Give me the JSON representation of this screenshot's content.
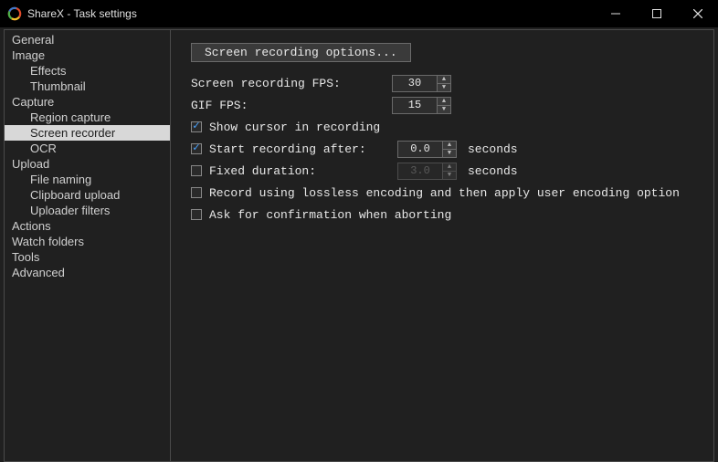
{
  "window": {
    "title": "ShareX - Task settings"
  },
  "sidebar": {
    "items": [
      {
        "label": "General",
        "level": 0,
        "selected": false
      },
      {
        "label": "Image",
        "level": 0,
        "selected": false
      },
      {
        "label": "Effects",
        "level": 1,
        "selected": false
      },
      {
        "label": "Thumbnail",
        "level": 1,
        "selected": false
      },
      {
        "label": "Capture",
        "level": 0,
        "selected": false
      },
      {
        "label": "Region capture",
        "level": 1,
        "selected": false
      },
      {
        "label": "Screen recorder",
        "level": 1,
        "selected": true
      },
      {
        "label": "OCR",
        "level": 1,
        "selected": false
      },
      {
        "label": "Upload",
        "level": 0,
        "selected": false
      },
      {
        "label": "File naming",
        "level": 1,
        "selected": false
      },
      {
        "label": "Clipboard upload",
        "level": 1,
        "selected": false
      },
      {
        "label": "Uploader filters",
        "level": 1,
        "selected": false
      },
      {
        "label": "Actions",
        "level": 0,
        "selected": false
      },
      {
        "label": "Watch folders",
        "level": 0,
        "selected": false
      },
      {
        "label": "Tools",
        "level": 0,
        "selected": false
      },
      {
        "label": "Advanced",
        "level": 0,
        "selected": false
      }
    ]
  },
  "main": {
    "options_button": "Screen recording options...",
    "fps_label": "Screen recording FPS:",
    "fps_value": "30",
    "gif_fps_label": "GIF FPS:",
    "gif_fps_value": "15",
    "show_cursor": {
      "label": "Show cursor in recording",
      "checked": true
    },
    "start_after": {
      "label": "Start recording after:",
      "checked": true,
      "value": "0.0",
      "suffix": "seconds"
    },
    "fixed_duration": {
      "label": "Fixed duration:",
      "checked": false,
      "value": "3.0",
      "suffix": "seconds"
    },
    "lossless": {
      "label": "Record using lossless encoding and then apply user encoding option",
      "checked": false
    },
    "ask_confirm": {
      "label": "Ask for confirmation when aborting",
      "checked": false
    }
  }
}
